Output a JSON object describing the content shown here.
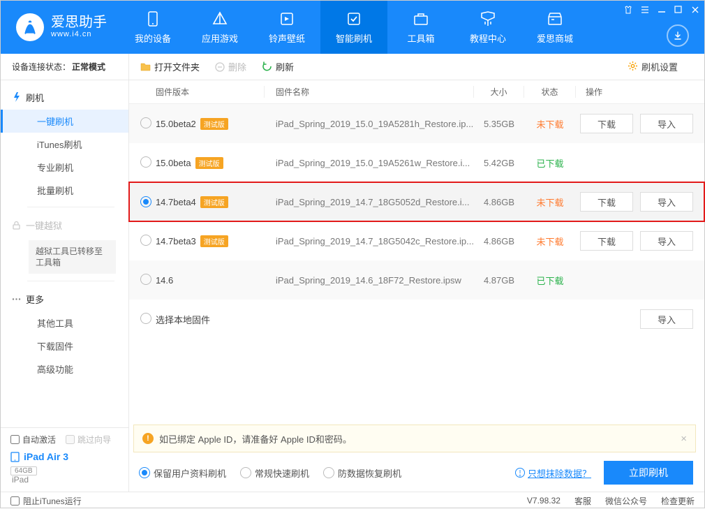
{
  "brand": {
    "name": "爱思助手",
    "site": "www.i4.cn"
  },
  "nav": [
    {
      "label": "我的设备"
    },
    {
      "label": "应用游戏"
    },
    {
      "label": "铃声壁纸"
    },
    {
      "label": "智能刷机"
    },
    {
      "label": "工具箱"
    },
    {
      "label": "教程中心"
    },
    {
      "label": "爱思商城"
    }
  ],
  "sidebar": {
    "conn_label": "设备连接状态：",
    "conn_mode": "正常模式",
    "cat1": "刷机",
    "subs1": [
      "一键刷机",
      "iTunes刷机",
      "专业刷机",
      "批量刷机"
    ],
    "cat2": "一键越狱",
    "box": "越狱工具已转移至工具箱",
    "cat3": "更多",
    "subs3": [
      "其他工具",
      "下载固件",
      "高级功能"
    ],
    "opt_auto": "自动激活",
    "opt_skip": "跳过向导",
    "device_name": "iPad Air 3",
    "device_tag": "64GB",
    "device_type": "iPad"
  },
  "toolbar": {
    "open": "打开文件夹",
    "delete": "删除",
    "refresh": "刷新",
    "settings": "刷机设置"
  },
  "columns": {
    "version": "固件版本",
    "name": "固件名称",
    "size": "大小",
    "status": "状态",
    "ops": "操作"
  },
  "badge_beta": "测试版",
  "rows": [
    {
      "version": "15.0beta2",
      "beta": true,
      "name": "iPad_Spring_2019_15.0_19A5281h_Restore.ip...",
      "size": "5.35GB",
      "status": "未下载",
      "status_cls": "not",
      "ops": [
        "下载",
        "导入"
      ],
      "selected": false
    },
    {
      "version": "15.0beta",
      "beta": true,
      "name": "iPad_Spring_2019_15.0_19A5261w_Restore.i...",
      "size": "5.42GB",
      "status": "已下载",
      "status_cls": "done",
      "ops": [],
      "selected": false
    },
    {
      "version": "14.7beta4",
      "beta": true,
      "name": "iPad_Spring_2019_14.7_18G5052d_Restore.i...",
      "size": "4.86GB",
      "status": "未下载",
      "status_cls": "not",
      "ops": [
        "下载",
        "导入"
      ],
      "selected": true,
      "highlight": true
    },
    {
      "version": "14.7beta3",
      "beta": true,
      "name": "iPad_Spring_2019_14.7_18G5042c_Restore.ip...",
      "size": "4.86GB",
      "status": "未下载",
      "status_cls": "not",
      "ops": [
        "下载",
        "导入"
      ],
      "selected": false
    },
    {
      "version": "14.6",
      "beta": false,
      "name": "iPad_Spring_2019_14.6_18F72_Restore.ipsw",
      "size": "4.87GB",
      "status": "已下载",
      "status_cls": "done",
      "ops": [],
      "selected": false
    }
  ],
  "local_row": {
    "label": "选择本地固件",
    "btn": "导入"
  },
  "info_bar": "如已绑定 Apple ID，请准备好 Apple ID和密码。",
  "modes": [
    "保留用户资料刷机",
    "常规快速刷机",
    "防数据恢复刷机"
  ],
  "erase_link": "只想抹除数据？",
  "flash_btn": "立即刷机",
  "footer": {
    "block_itunes": "阻止iTunes运行",
    "version": "V7.98.32",
    "svc": "客服",
    "wx": "微信公众号",
    "upd": "检查更新"
  }
}
